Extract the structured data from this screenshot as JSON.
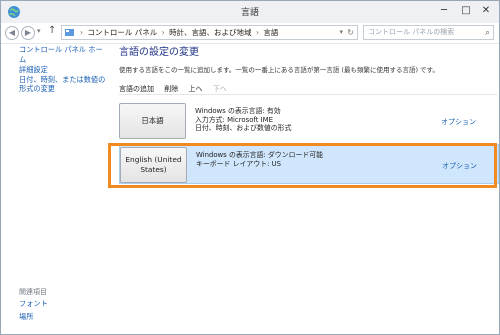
{
  "window": {
    "title": "言語"
  },
  "navbar": {
    "breadcrumb": [
      "コントロール パネル",
      "時計、言語、および地域",
      "言語"
    ],
    "search_placeholder": "コントロール パネルの検索"
  },
  "sidebar": {
    "home": "コントロール パネル ホーム",
    "advanced": "詳細設定",
    "date_format": "日付、時刻、または数値の形式の変更",
    "related_heading": "関連項目",
    "fonts": "フォント",
    "location": "場所"
  },
  "main": {
    "title": "言語の設定の変更",
    "description": "使用する言語をこの一覧に追加します。一覧の一番上にある言語が第一言語 (最も頻繁に使用する言語) です。",
    "toolbar": {
      "add": "言語の追加",
      "remove": "削除",
      "up": "上へ",
      "down": "下へ"
    },
    "languages": [
      {
        "name": "日本語",
        "info": [
          "Windows の表示言語: 有効",
          "入力方式: Microsoft IME",
          "日付、時刻、および数値の形式"
        ],
        "option": "オプション"
      },
      {
        "name": "English (United States)",
        "info": [
          "Windows の表示言語: ダウンロード可能",
          "キーボード レイアウト: US"
        ],
        "option": "オプション"
      }
    ]
  },
  "colors": {
    "highlight_border": "#f18a1f",
    "link": "#1a5fb4",
    "selected_row": "#cfe6fc"
  }
}
